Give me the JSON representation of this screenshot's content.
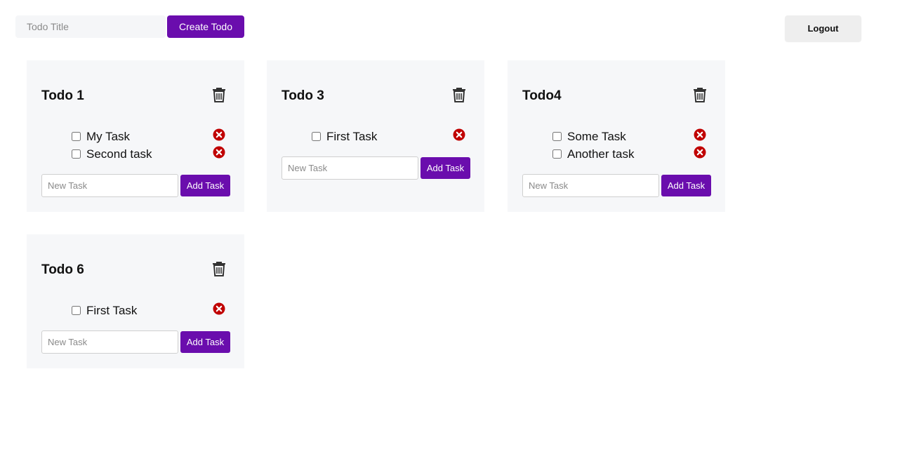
{
  "header": {
    "title_input_placeholder": "Todo Title",
    "title_input_value": "",
    "create_label": "Create Todo",
    "logout_label": "Logout"
  },
  "colors": {
    "accent": "#6a0dad",
    "delete_red": "#c00000",
    "card_bg": "#f6f7f9"
  },
  "todos": [
    {
      "title": "Todo 1",
      "tasks": [
        {
          "label": "My Task",
          "checked": false
        },
        {
          "label": "Second task",
          "checked": false
        }
      ],
      "new_task_placeholder": "New Task",
      "add_label": "Add Task"
    },
    {
      "title": "Todo 3",
      "tasks": [
        {
          "label": "First Task",
          "checked": false
        }
      ],
      "new_task_placeholder": "New Task",
      "add_label": "Add Task"
    },
    {
      "title": "Todo4",
      "tasks": [
        {
          "label": "Some Task",
          "checked": false
        },
        {
          "label": "Another task",
          "checked": false
        }
      ],
      "new_task_placeholder": "New Task",
      "add_label": "Add Task"
    },
    {
      "title": "Todo 6",
      "tasks": [
        {
          "label": "First Task",
          "checked": false
        }
      ],
      "new_task_placeholder": "New Task",
      "add_label": "Add Task"
    }
  ],
  "icons": {
    "delete_todo": "trash-icon",
    "delete_task": "close-circle-icon"
  }
}
